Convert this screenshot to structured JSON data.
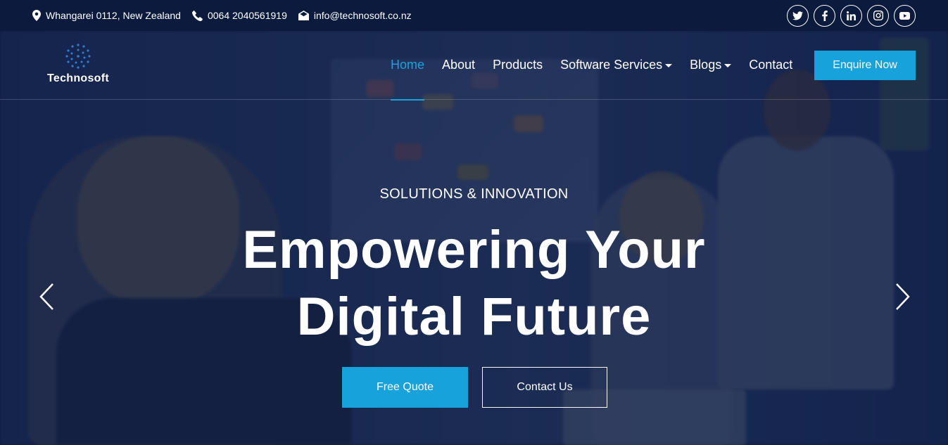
{
  "topbar": {
    "address": "Whangarei 0112, New Zealand",
    "phone": "0064 2040561919",
    "email": "info@technosoft.co.nz",
    "social_icons": [
      "twitter-icon",
      "facebook-icon",
      "linkedin-icon",
      "instagram-icon",
      "youtube-icon"
    ]
  },
  "brand": {
    "name": "Technosoft"
  },
  "nav": {
    "items": [
      {
        "label": "Home",
        "active": true
      },
      {
        "label": "About"
      },
      {
        "label": "Products"
      },
      {
        "label": "Software Services",
        "dropdown": true
      },
      {
        "label": "Blogs",
        "dropdown": true
      },
      {
        "label": "Contact"
      }
    ],
    "cta": "Enquire Now"
  },
  "hero": {
    "kicker": "SOLUTIONS & INNOVATION",
    "headline_line1": "Empowering Your",
    "headline_line2": "Digital Future",
    "primary_button": "Free Quote",
    "secondary_button": "Contact Us"
  },
  "colors": {
    "accent": "#17a2dc",
    "topbar": "#0b1a3d",
    "overlay": "#101f46"
  }
}
